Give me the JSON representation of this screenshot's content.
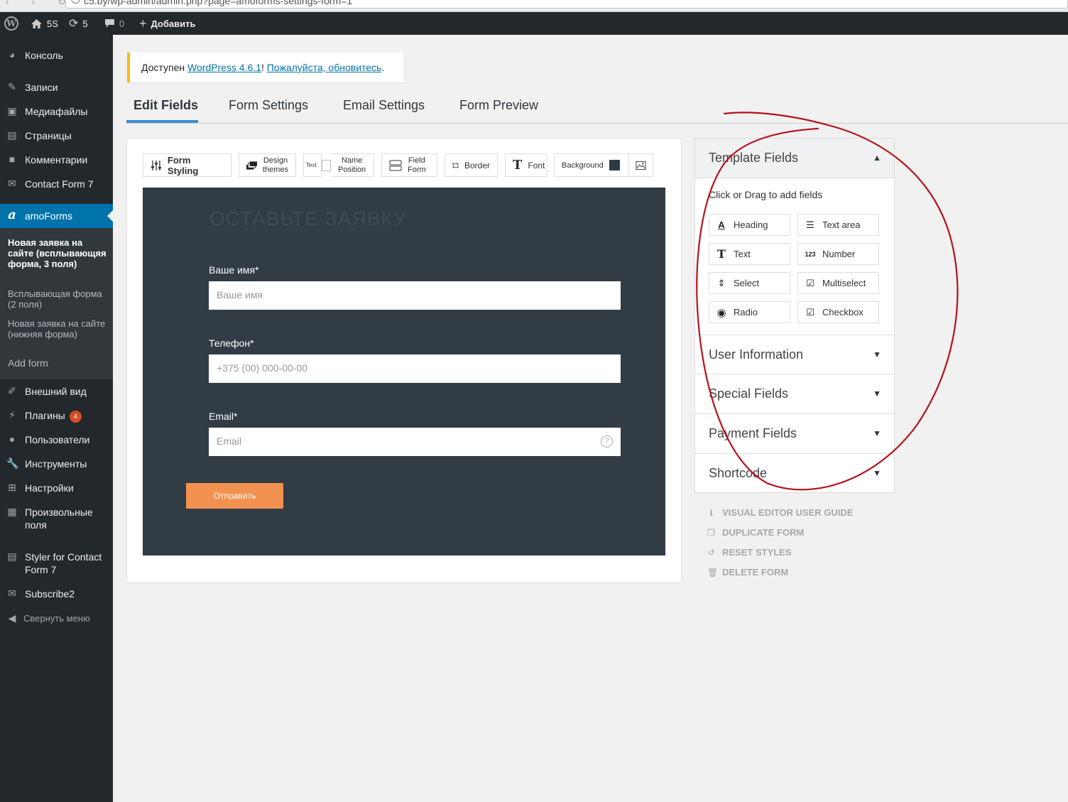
{
  "browser": {
    "url": "c5.by/wp-admin/admin.php?page=amoforms-settings-form=1",
    "nav": "‹ › ↻"
  },
  "adminbar": {
    "site": "5S",
    "updates": "5",
    "comments": "0",
    "add": "Добавить"
  },
  "sidebar": {
    "items": [
      {
        "label": "Консоль",
        "icon": "dashboard-icon"
      },
      {
        "label": "Записи",
        "icon": "pin-icon"
      },
      {
        "label": "Медиафайлы",
        "icon": "media-icon"
      },
      {
        "label": "Страницы",
        "icon": "page-icon"
      },
      {
        "label": "Комментарии",
        "icon": "comment-icon"
      },
      {
        "label": "Contact Form 7",
        "icon": "mail-icon"
      },
      {
        "label": "amoForms",
        "icon": "amo-icon"
      },
      {
        "label": "Внешний вид",
        "icon": "brush-icon"
      },
      {
        "label": "Плагины",
        "icon": "plugin-icon",
        "badge": "4"
      },
      {
        "label": "Пользователи",
        "icon": "user-icon"
      },
      {
        "label": "Инструменты",
        "icon": "wrench-icon"
      },
      {
        "label": "Настройки",
        "icon": "settings-icon"
      },
      {
        "label": "Произвольные поля",
        "icon": "fields-icon"
      },
      {
        "label": "Styler for Contact Form 7",
        "icon": "styler-icon"
      },
      {
        "label": "Subscribe2",
        "icon": "subscribe-icon"
      },
      {
        "label": "Свернуть меню",
        "icon": "collapse-icon"
      }
    ],
    "submenu": [
      "Новая заявка на сайте (всплывающяя форма, 3 поля)",
      "Всплывающая форма (2 поля)",
      "Новая заявка на сайте (нижняя форма)",
      "Add form"
    ]
  },
  "notice": {
    "prefix": "Доступен ",
    "link1": "WordPress 4.6.1",
    "mid": "! ",
    "link2": "Пожалуйста, обновитесь",
    "suffix": "."
  },
  "tabs": [
    "Edit Fields",
    "Form Settings",
    "Email Settings",
    "Form Preview"
  ],
  "toolbar": {
    "form_styling": "Form Styling",
    "design_1": "Design",
    "design_2": "themes",
    "text_small": "Text",
    "name_1": "Name",
    "name_2": "Position",
    "field_1": "Field",
    "field_2": "Form",
    "border": "Border",
    "font": "Font",
    "background": "Background",
    "background_color": "#2f3b44"
  },
  "form": {
    "title": "ОСТАВЬТЕ ЗАЯВКУ",
    "fields": [
      {
        "label": "Ваше имя*",
        "placeholder": "Ваше имя"
      },
      {
        "label": "Телефон*",
        "placeholder": "+375 (00) 000-00-00"
      },
      {
        "label": "Email*",
        "placeholder": "Email"
      }
    ],
    "help": "?",
    "submit": "Отправить",
    "bg_color": "#323c45",
    "button_color": "#f39250"
  },
  "panel": {
    "template_title": "Template Fields",
    "hint": "Click or Drag to add fields",
    "fields": [
      {
        "label": "Heading",
        "icon": "heading-icon",
        "glyph": "A"
      },
      {
        "label": "Text area",
        "icon": "textarea-icon",
        "glyph": "☰"
      },
      {
        "label": "Text",
        "icon": "text-icon",
        "glyph": "T"
      },
      {
        "label": "Number",
        "icon": "number-icon",
        "glyph": "123"
      },
      {
        "label": "Select",
        "icon": "select-icon",
        "glyph": "⇕"
      },
      {
        "label": "Multiselect",
        "icon": "multiselect-icon",
        "glyph": "☑"
      },
      {
        "label": "Radio",
        "icon": "radio-icon",
        "glyph": "◉"
      },
      {
        "label": "Checkbox",
        "icon": "checkbox-icon",
        "glyph": "☑"
      }
    ],
    "sections": [
      "User Information",
      "Special Fields",
      "Payment Fields",
      "Shortcode"
    ]
  },
  "tools": [
    {
      "label": "VISUAL EDITOR USER GUIDE",
      "icon": "info-icon"
    },
    {
      "label": "DUPLICATE FORM",
      "icon": "duplicate-icon"
    },
    {
      "label": "RESET STYLES",
      "icon": "reset-icon"
    },
    {
      "label": "DELETE FORM",
      "icon": "trash-icon"
    }
  ],
  "annotation_color": "#b5121b"
}
